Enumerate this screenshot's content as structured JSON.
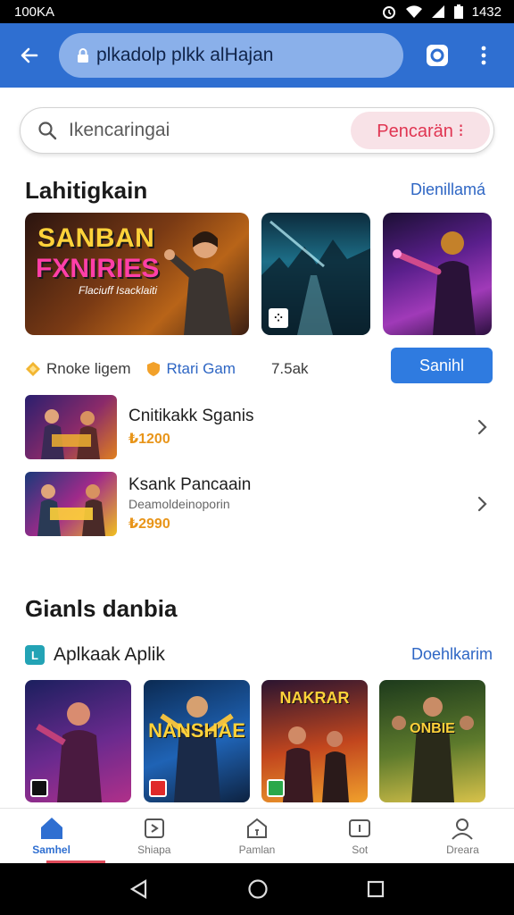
{
  "status_bar": {
    "left": "100KA",
    "time": "1432"
  },
  "address_bar": {
    "url": "plkadolp plkk alHajan"
  },
  "search": {
    "placeholder": "Ikencaringai",
    "button": "Pencarän ⁝"
  },
  "featured": {
    "title": "Lahitigkain",
    "link": "Dienillamá",
    "banner_title_1": "SANBAN",
    "banner_title_2": "FXNIRIES",
    "banner_subtitle": "Flaciuff Isacklaiti",
    "meta_1": "Rnoke ligem",
    "meta_2": "Rtari Gam",
    "meta_3": "7.5ak",
    "save_button": "Sanihl"
  },
  "list": [
    {
      "title": "Cnitikakk Sganis",
      "subtitle": "",
      "price": "₺1200"
    },
    {
      "title": "Ksank Pancaain",
      "subtitle": "Deamoldeinoporin",
      "price": "₺2990"
    }
  ],
  "games_section": {
    "title": "Gianls danbia",
    "row_label": "Aplkaak Aplik",
    "row_badge": "L",
    "row_link": "Doehlkarim",
    "cards": [
      {
        "title": "",
        "colors": [
          "#1b1f5e",
          "#6a2a8e",
          "#b0308a"
        ]
      },
      {
        "title": "NANSHAE",
        "colors": [
          "#0b2a52",
          "#1f63b5",
          "#0d2240"
        ]
      },
      {
        "title": "NAKRAR",
        "colors": [
          "#2a1430",
          "#c2461e",
          "#f0a02c"
        ]
      },
      {
        "title": "ONBIE",
        "colors": [
          "#1d3a1c",
          "#5d7a2c",
          "#d8c24a"
        ]
      }
    ]
  },
  "bottom_nav": [
    {
      "label": "Samhel",
      "icon": "home-icon",
      "active": true
    },
    {
      "label": "Shiapa",
      "icon": "share-icon",
      "active": false
    },
    {
      "label": "Pamlan",
      "icon": "library-icon",
      "active": false
    },
    {
      "label": "Sot",
      "icon": "tablet-icon",
      "active": false
    },
    {
      "label": "Dreara",
      "icon": "profile-icon",
      "active": false
    }
  ],
  "colors": {
    "primary": "#2f6fd1",
    "accent_pink": "#e03552",
    "price_orange": "#e8951a"
  }
}
